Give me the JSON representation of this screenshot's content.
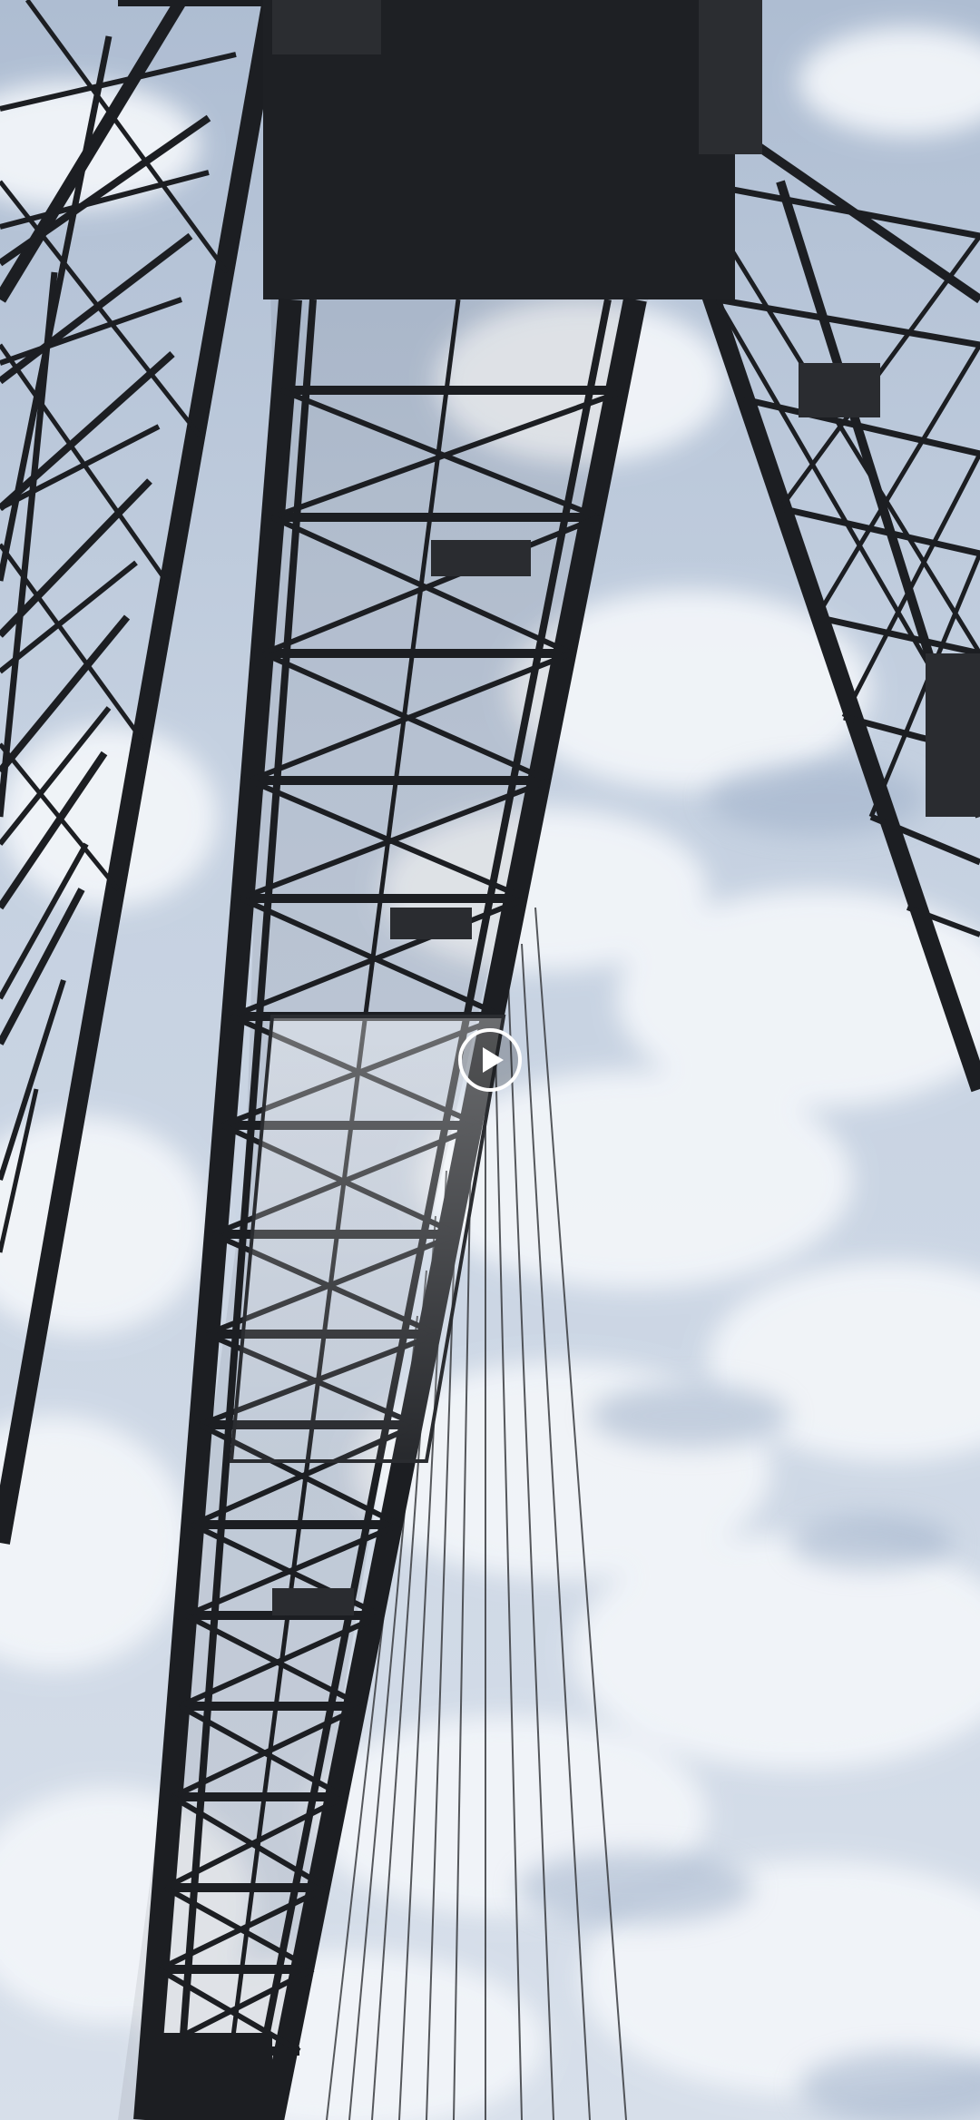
{
  "viewer": {
    "media_type": "video",
    "subject": "transporter-bridge-from-below",
    "controls": {
      "play_button": {
        "icon": "play-icon",
        "state": "paused",
        "color": "#ffffff"
      }
    }
  },
  "colors": {
    "sky": "#c9d5e4",
    "cloud": "#f1f4f8",
    "steel": "#1c1e22"
  }
}
